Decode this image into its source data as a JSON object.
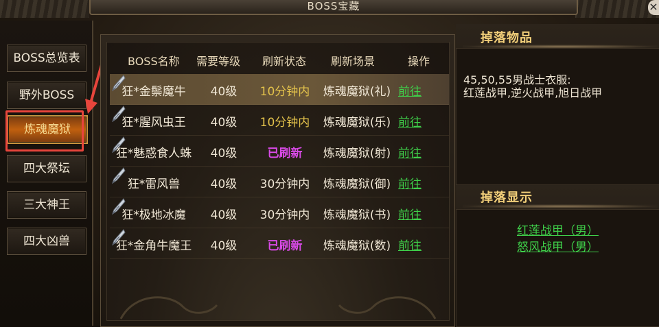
{
  "window": {
    "title": "BOSS宝藏",
    "close_icon": "close-icon"
  },
  "sidebar": {
    "items": [
      {
        "label": "BOSS总览表"
      },
      {
        "label": "野外BOSS"
      },
      {
        "label": "炼魂魔狱"
      },
      {
        "label": "四大祭坛"
      },
      {
        "label": "三大神王"
      },
      {
        "label": "四大凶兽"
      }
    ],
    "active": "炼魂魔狱"
  },
  "table": {
    "headers": [
      "BOSS名称",
      "需要等级",
      "刷新状态",
      "刷新场景",
      "操作"
    ],
    "rows": [
      {
        "name": "狂*金鬃魔牛",
        "level": "40级",
        "status": "10分钟内",
        "scene": "炼魂魔狱(礼)",
        "action": "前往"
      },
      {
        "name": "狂*腥风虫王",
        "level": "40级",
        "status": "10分钟内",
        "scene": "炼魂魔狱(乐)",
        "action": "前往"
      },
      {
        "name": "狂*魅惑食人蛛",
        "level": "40级",
        "status": "已刷新",
        "scene": "炼魂魔狱(射)",
        "action": "前往"
      },
      {
        "name": "狂*雷风兽",
        "level": "40级",
        "status": "30分钟内",
        "scene": "炼魂魔狱(御)",
        "action": "前往"
      },
      {
        "name": "狂*极地冰魔",
        "level": "40级",
        "status": "30分钟内",
        "scene": "炼魂魔狱(书)",
        "action": "前往"
      },
      {
        "name": "狂*金角牛魔王",
        "level": "40级",
        "status": "已刷新",
        "scene": "炼魂魔狱(数)",
        "action": "前往"
      }
    ]
  },
  "drops": {
    "title": "掉落物品",
    "text": "45,50,55男战士衣服:\n红莲战甲,逆火战甲,旭日战甲"
  },
  "display": {
    "title": "掉落显示",
    "items": [
      "红莲战甲（男）",
      "怒风战甲（男）"
    ]
  },
  "colors": {
    "ready": "#d84ae6",
    "timer": "#e3c24b",
    "link": "#3fd04a",
    "title_gold": "#f2cf7a",
    "annotation_red": "#e8453c"
  }
}
